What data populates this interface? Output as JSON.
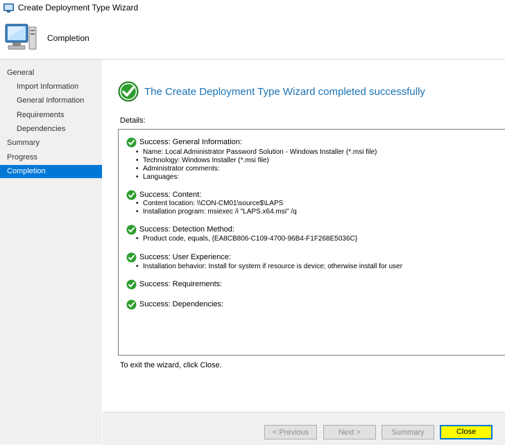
{
  "window": {
    "title": "Create Deployment Type Wizard"
  },
  "header": {
    "page_title": "Completion"
  },
  "sidebar": {
    "items": [
      {
        "label": "General",
        "indent": false,
        "active": false
      },
      {
        "label": "Import Information",
        "indent": true,
        "active": false
      },
      {
        "label": "General Information",
        "indent": true,
        "active": false
      },
      {
        "label": "Requirements",
        "indent": true,
        "active": false
      },
      {
        "label": "Dependencies",
        "indent": true,
        "active": false
      },
      {
        "label": "Summary",
        "indent": false,
        "active": false
      },
      {
        "label": "Progress",
        "indent": false,
        "active": false
      },
      {
        "label": "Completion",
        "indent": false,
        "active": true
      }
    ]
  },
  "main": {
    "heading": "The Create Deployment Type Wizard completed successfully",
    "details_label": "Details:",
    "entries": [
      {
        "title": "Success: General Information:",
        "bullets": [
          "Name: Local Administrator Password Solution - Windows Installer (*.msi file)",
          "Technology: Windows Installer (*.msi file)",
          "Administrator comments:",
          "Languages:"
        ]
      },
      {
        "title": "Success: Content:",
        "bullets": [
          "Content location: \\\\CON-CM01\\source$\\LAPS",
          "Installation program: msiexec /i \"LAPS.x64.msi\" /q"
        ]
      },
      {
        "title": "Success: Detection Method:",
        "bullets": [
          "Product code, equals, {EA8CB806-C109-4700-96B4-F1F268E5036C}"
        ]
      },
      {
        "title": "Success: User Experience:",
        "bullets": [
          "Installation behavior: Install for system if resource is device; otherwise install for user"
        ]
      },
      {
        "title": "Success: Requirements:",
        "bullets": []
      },
      {
        "title": "Success: Dependencies:",
        "bullets": []
      }
    ],
    "exit_note": "To exit the wizard, click Close."
  },
  "buttons": {
    "previous": "< Previous",
    "next": "Next >",
    "summary": "Summary",
    "close": "Close"
  },
  "colors": {
    "accent": "#0078d7",
    "heading": "#1a73b5",
    "success_green": "#2e9e2e",
    "close_highlight": "#ffff00"
  }
}
